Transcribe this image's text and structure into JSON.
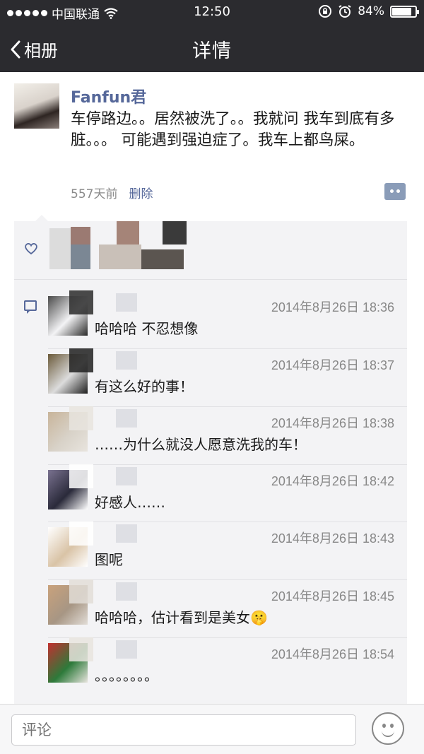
{
  "status_bar": {
    "carrier": "中国联通",
    "time": "12:50",
    "battery_percent": "84%",
    "battery_level": 0.84
  },
  "nav": {
    "back_label": "相册",
    "title": "详情"
  },
  "post": {
    "author": "Fanfun君",
    "content": "车停路边。。居然被洗了。。我就问 我车到底有多脏。。。 可能遇到强迫症了。我车上都鸟屎。",
    "time_ago": "557天前",
    "delete_label": "删除"
  },
  "comments": [
    {
      "time": "2014年8月26日 18:36",
      "text": "哈哈哈 不忍想像"
    },
    {
      "time": "2014年8月26日 18:37",
      "text": "有这么好的事！"
    },
    {
      "time": "2014年8月26日 18:38",
      "text": "……为什么就没人愿意洗我的车！"
    },
    {
      "time": "2014年8月26日 18:42",
      "text": "好感人……"
    },
    {
      "time": "2014年8月26日 18:43",
      "text": "图呢"
    },
    {
      "time": "2014年8月26日 18:45",
      "text": "哈哈哈，估计看到是美女🤫"
    },
    {
      "time": "2014年8月26日 18:54",
      "text": "。。。。。。。。"
    }
  ],
  "input": {
    "placeholder": "评论"
  },
  "icons": {
    "back": "chevron-left-icon",
    "wifi": "wifi-icon",
    "lock": "rotation-lock-icon",
    "alarm": "alarm-icon",
    "like": "heart-icon",
    "comment": "comment-icon",
    "more": "more-options-icon",
    "emoji": "emoji-icon"
  },
  "colors": {
    "nav_bg": "#2b2b2f",
    "link": "#56689a",
    "panel_bg": "#f3f3f5"
  }
}
